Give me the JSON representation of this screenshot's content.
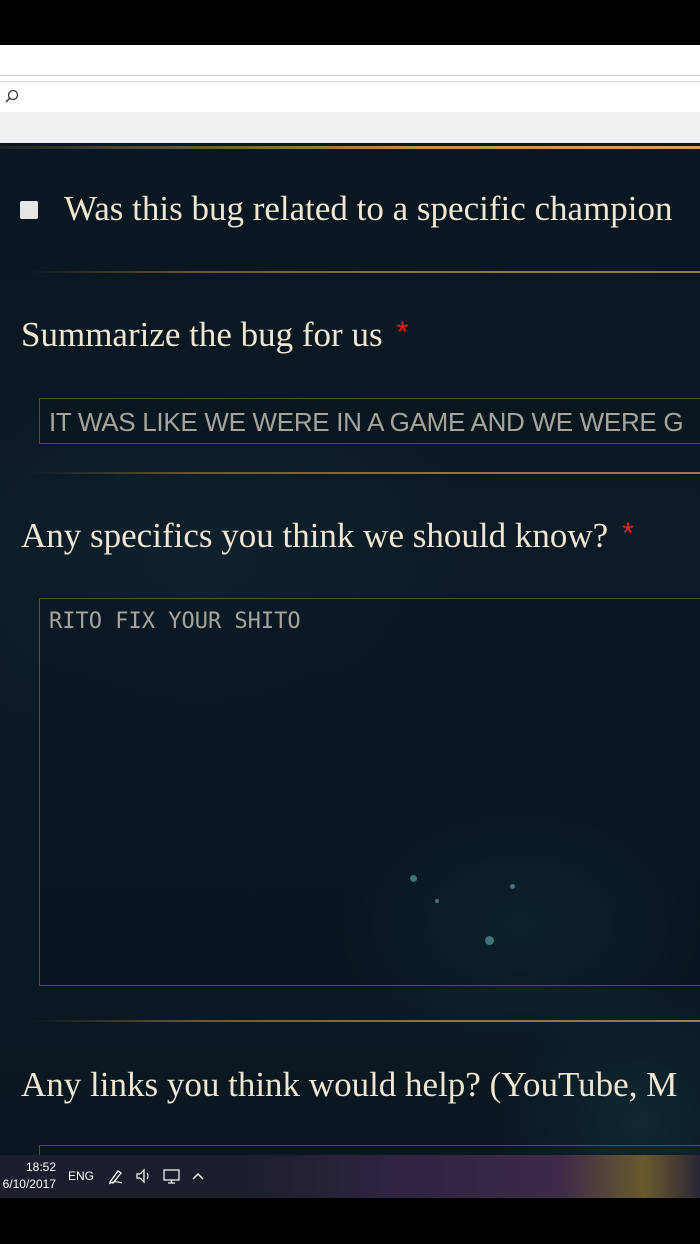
{
  "form": {
    "champion_question": "Was this bug related to a specific champion",
    "summary": {
      "label": "Summarize the bug for us",
      "required_mark": "*",
      "value": "IT WAS LIKE WE WERE IN A GAME AND WE WERE G"
    },
    "specifics": {
      "label": "Any specifics you think we should know?",
      "required_mark": "*",
      "value": "RITO FIX YOUR SHITO"
    },
    "links": {
      "label": "Any links you think would help? (YouTube, M"
    }
  },
  "taskbar": {
    "time": "18:52",
    "date": "6/10/2017",
    "language": "ENG",
    "tray_icons": [
      "pen-icon",
      "volume-icon",
      "network-icon",
      "chevron-up-icon"
    ]
  },
  "colors": {
    "page_bg": "#0a1620",
    "gold_accent": "#b89455",
    "question_text": "#f0e6d2",
    "required_star": "#e3231b",
    "field_text": "#a8a49b"
  }
}
